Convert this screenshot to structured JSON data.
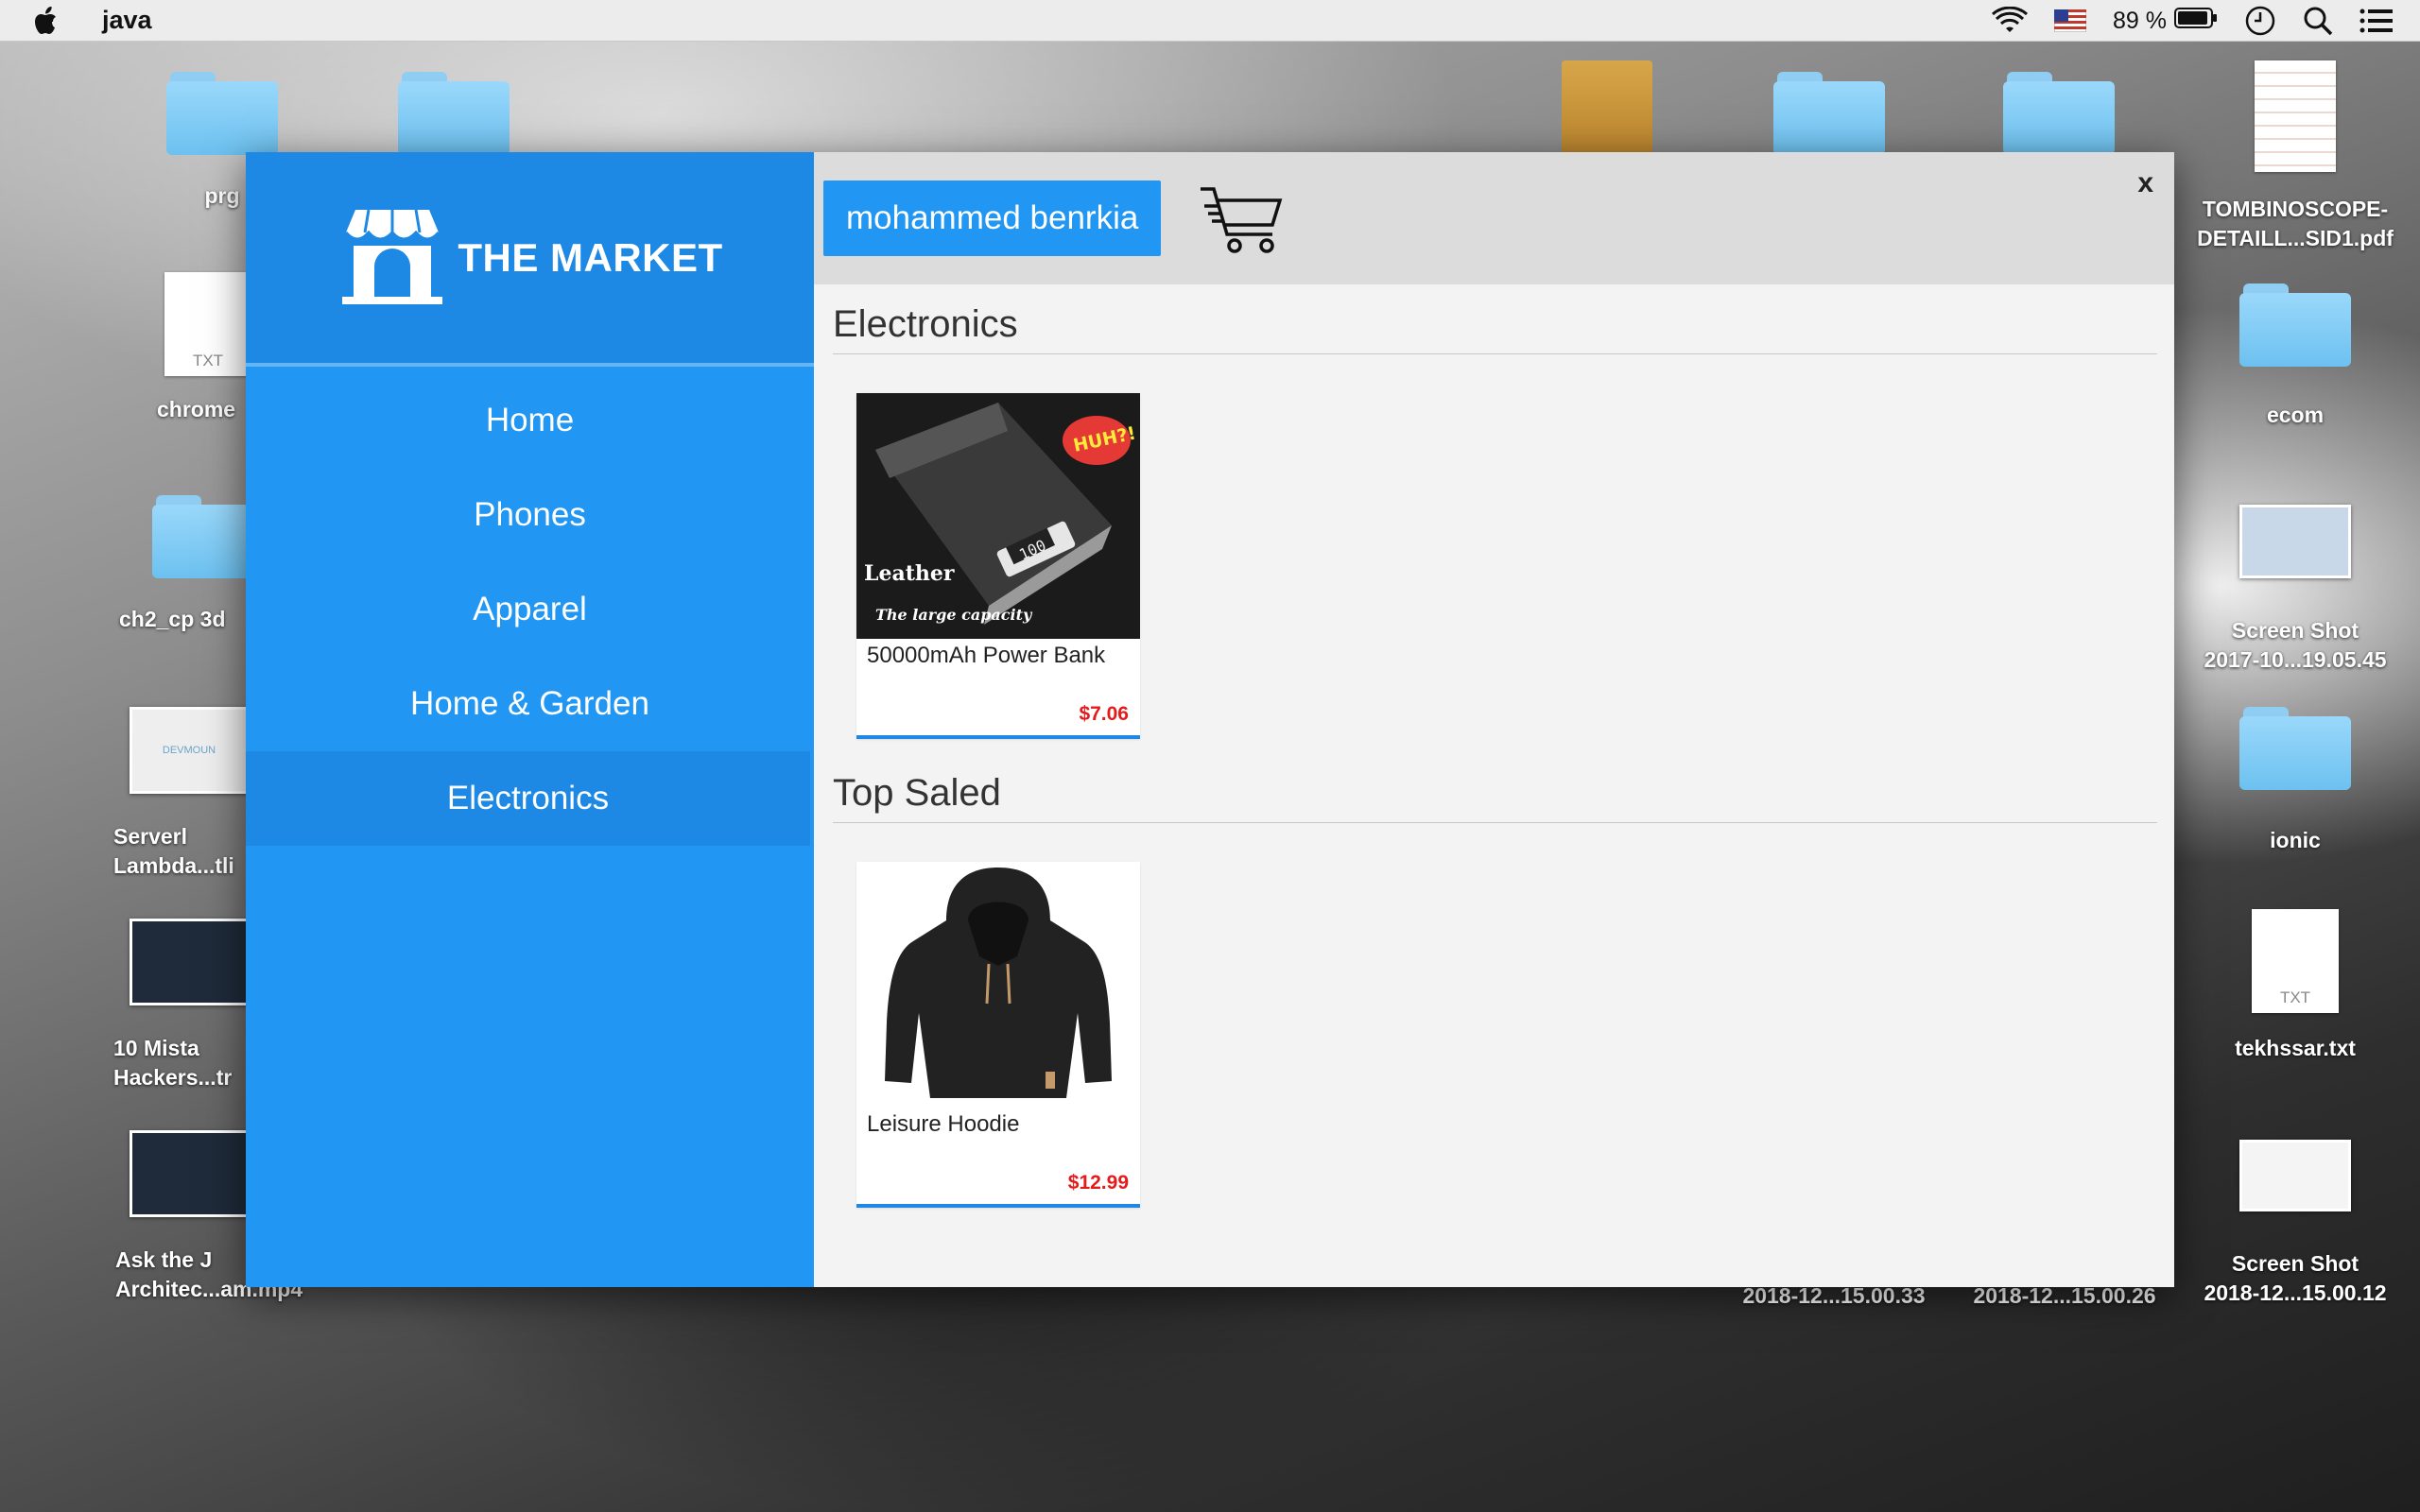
{
  "menubar": {
    "app_name": "java",
    "battery": "89 %"
  },
  "desktop_icons": [
    {
      "label": "prg",
      "kind": "folder"
    },
    {
      "label": "chrome",
      "kind": "txt"
    },
    {
      "label": "ch2_cp 3d",
      "kind": "folder"
    },
    {
      "label": "Serverl\nLambda...tli",
      "kind": "thumb"
    },
    {
      "label": "10 Mista\nHackers...tr",
      "kind": "thumb"
    },
    {
      "label": "Ask the J\nArchitec...am.mp4",
      "kind": "thumb"
    },
    {
      "label": "TOMBINOSCOPE-\nDETAILL...SID1.pdf",
      "kind": "pdf"
    },
    {
      "label": "ecom",
      "kind": "folder"
    },
    {
      "label": "Screen Shot\n2017-10...19.05.45",
      "kind": "thumb"
    },
    {
      "label": "ionic",
      "kind": "folder"
    },
    {
      "label": "tekhssar.txt",
      "kind": "txt"
    },
    {
      "label": "Screen Shot\n2018-12...15.00.12",
      "kind": "thumb"
    },
    {
      "label": "2018-12...15.00.33",
      "kind": "label"
    },
    {
      "label": "2018-12...15.00.26",
      "kind": "label"
    }
  ],
  "txt_ext": "TXT",
  "devmountain_text": "DEVMOUN",
  "brand": {
    "title": "THE MARKET",
    "icon": "store-icon"
  },
  "nav": {
    "items": [
      {
        "label": "Home"
      },
      {
        "label": "Phones"
      },
      {
        "label": "Apparel"
      },
      {
        "label": "Home & Garden"
      },
      {
        "label": "Electronics",
        "active": true
      }
    ]
  },
  "topbar": {
    "user_name": "mohammed benrkia",
    "cart_icon": "shopping-cart-icon",
    "close_label": "x"
  },
  "sections": [
    {
      "title": "Electronics",
      "products": [
        {
          "name": "50000mAh Power Bank",
          "price": "$7.06",
          "image_text_1": "Leather",
          "image_text_2": "The large capacity",
          "image_badge": "HUH?!",
          "image_display": "100"
        }
      ]
    },
    {
      "title": "Top Saled",
      "products": [
        {
          "name": "Leisure Hoodie",
          "price": "$12.99"
        }
      ]
    }
  ],
  "colors": {
    "sidebar": "#2196f3",
    "sidebar_dark": "#1e88e5",
    "price": "#e41b1b"
  }
}
